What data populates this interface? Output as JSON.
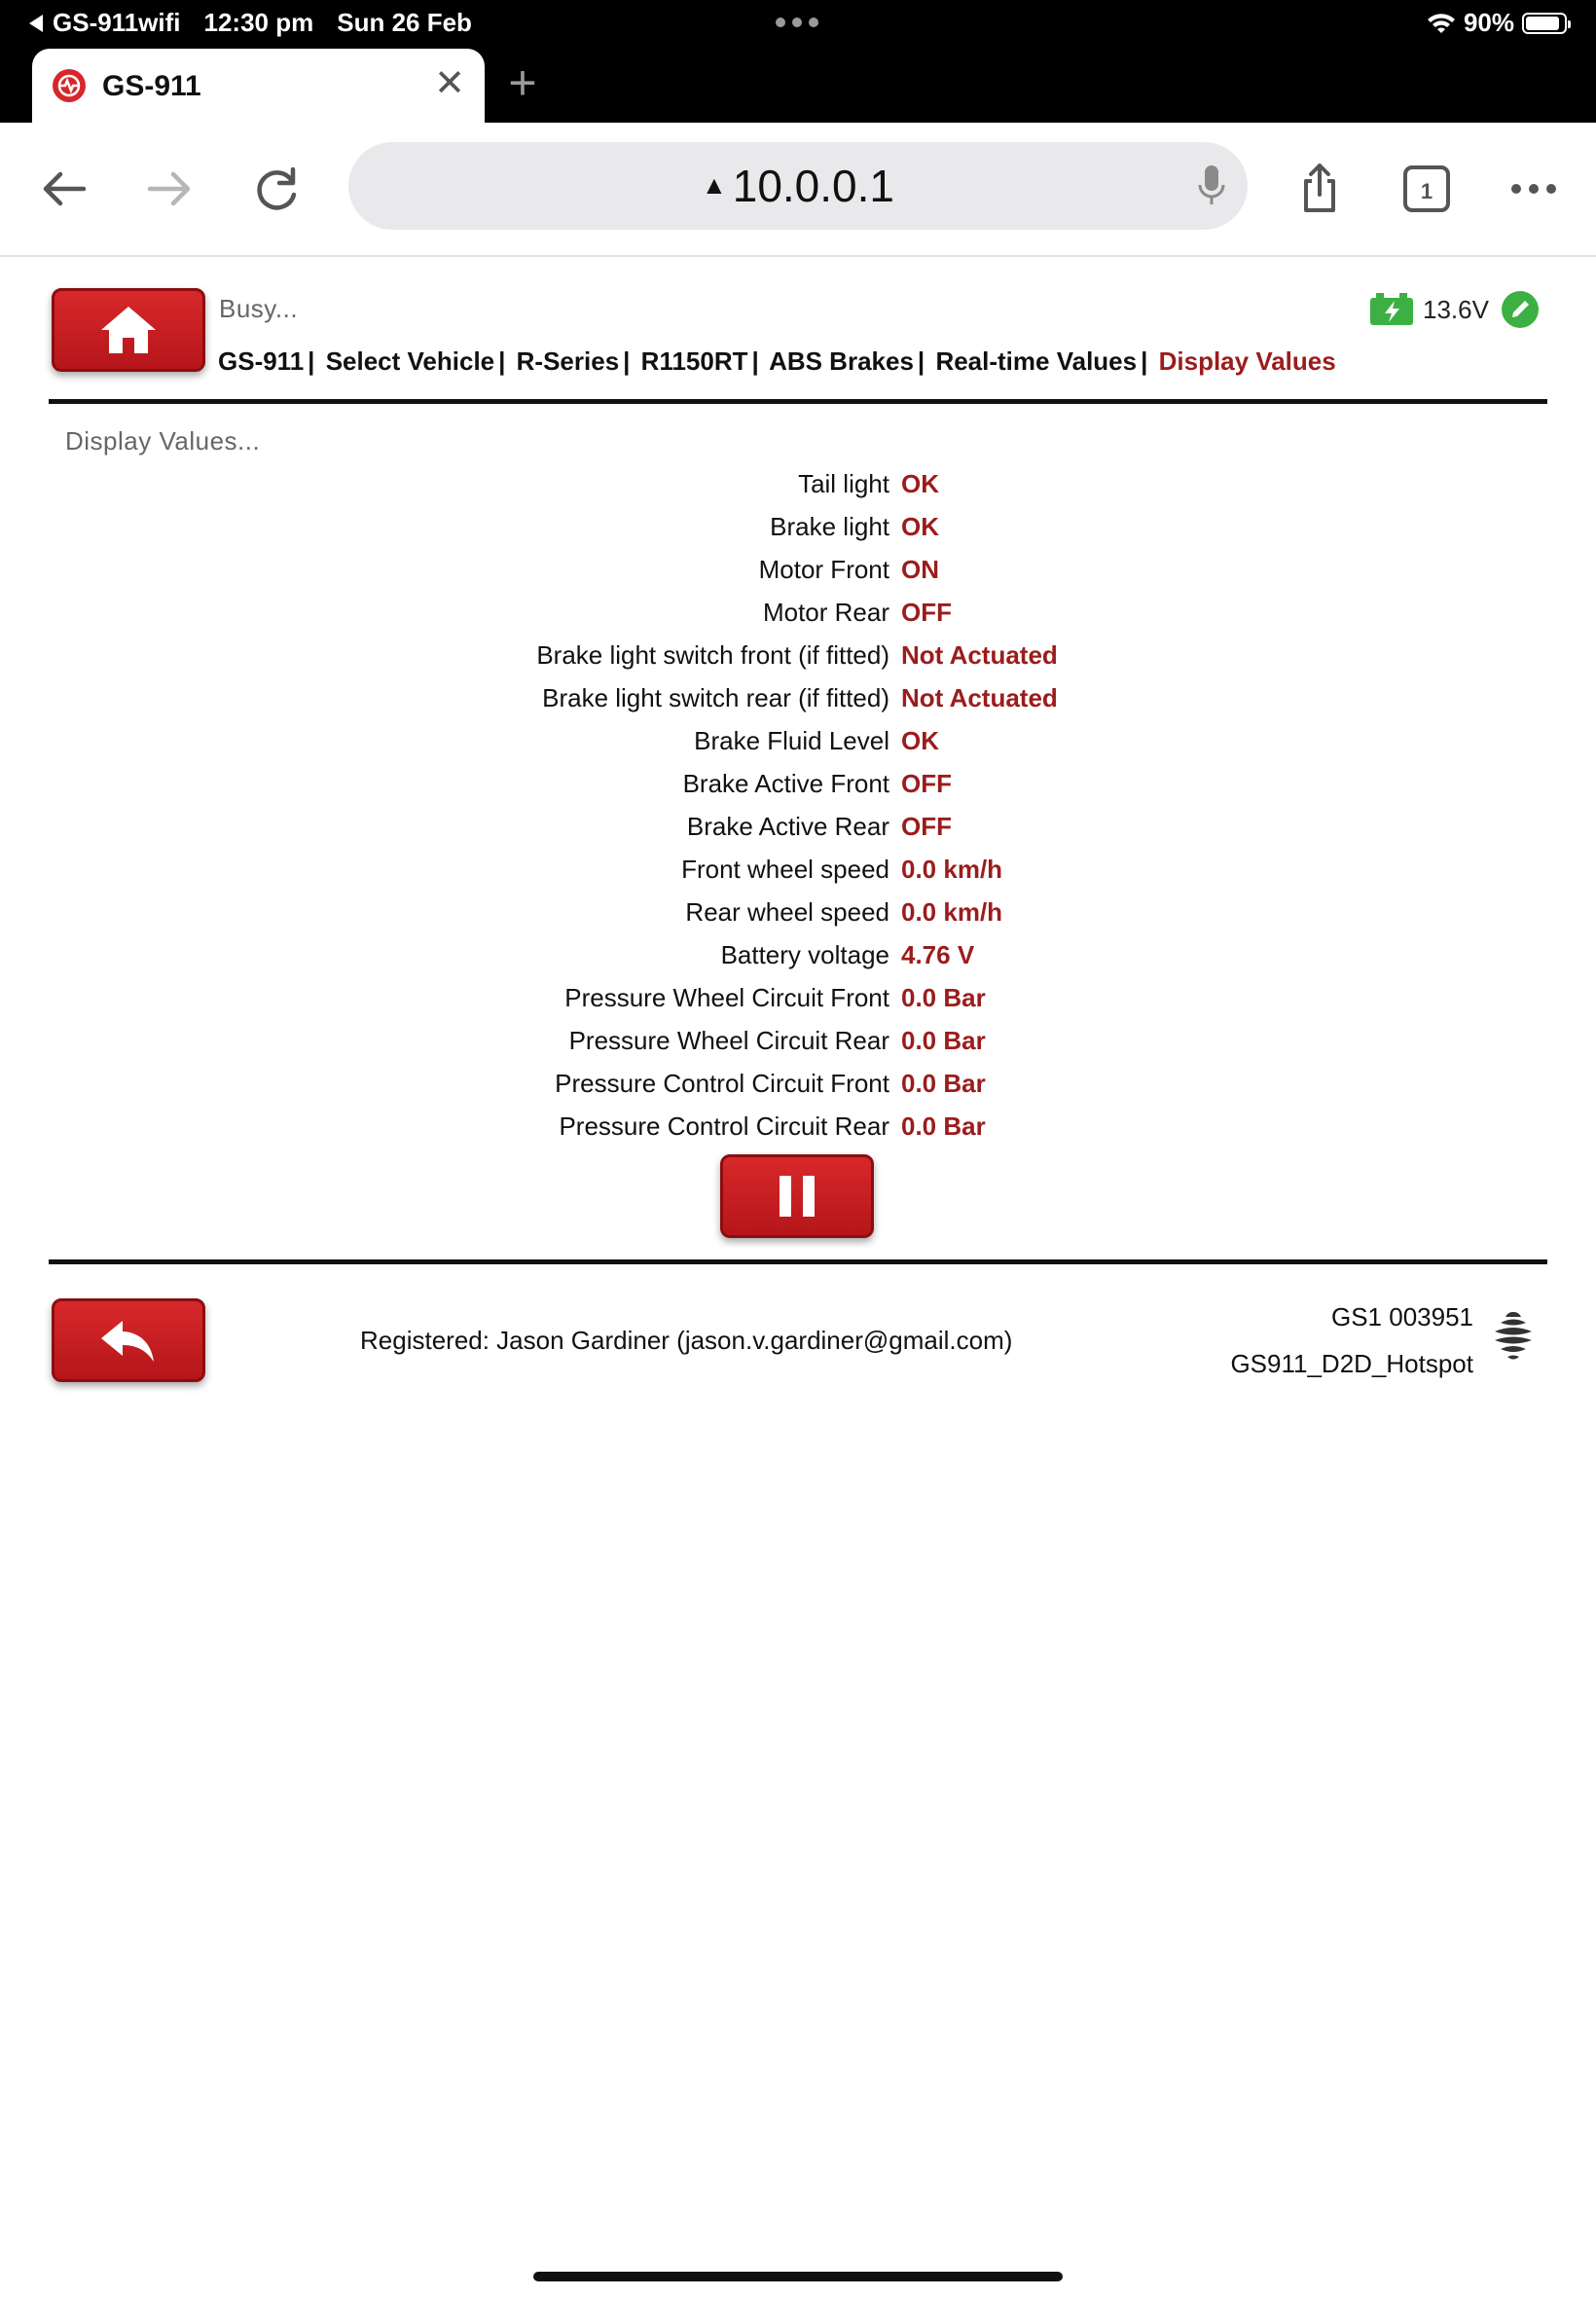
{
  "status_bar": {
    "carrier": "GS-911wifi",
    "time": "12:30 pm",
    "date": "Sun 26 Feb",
    "battery_percent": "90%",
    "battery_level": 0.9
  },
  "tab": {
    "title": "GS-911",
    "favicon": "gs911-logo-icon",
    "close_icon": "close-icon",
    "new_tab_icon": "plus-icon"
  },
  "toolbar": {
    "back_icon": "arrow-left-icon",
    "forward_icon": "arrow-right-icon",
    "reload_icon": "reload-icon",
    "url": "10.0.0.1",
    "url_warning_icon": "warning-triangle-icon",
    "mic_icon": "microphone-icon",
    "share_icon": "share-icon",
    "tabs_count": "1",
    "more_icon": "more-dots-icon"
  },
  "header": {
    "status": "Busy...",
    "breadcrumbs": [
      "GS-911",
      "Select Vehicle",
      "R-Series",
      "R1150RT",
      "ABS Brakes",
      "Real-time Values"
    ],
    "current_crumb": "Display Values",
    "separator": "|",
    "voltage": "13.6V",
    "battery_icon": "battery-charging-icon",
    "ok_icon": "pencil-check-icon",
    "home_icon": "home-icon"
  },
  "main": {
    "section_title": "Display Values...",
    "rows": [
      {
        "label": "Tail light",
        "value": "OK"
      },
      {
        "label": "Brake light",
        "value": "OK"
      },
      {
        "label": "Motor Front",
        "value": "ON"
      },
      {
        "label": "Motor Rear",
        "value": "OFF"
      },
      {
        "label": "Brake light switch front (if fitted)",
        "value": "Not Actuated"
      },
      {
        "label": "Brake light switch rear (if fitted)",
        "value": "Not Actuated"
      },
      {
        "label": "Brake Fluid Level",
        "value": "OK"
      },
      {
        "label": "Brake Active Front",
        "value": "OFF"
      },
      {
        "label": "Brake Active Rear",
        "value": "OFF"
      },
      {
        "label": "Front wheel speed",
        "value": "0.0 km/h"
      },
      {
        "label": "Rear wheel speed",
        "value": "0.0 km/h"
      },
      {
        "label": "Battery voltage",
        "value": "4.76 V"
      },
      {
        "label": "Pressure Wheel Circuit Front",
        "value": "0.0 Bar"
      },
      {
        "label": "Pressure Wheel Circuit Rear",
        "value": "0.0 Bar"
      },
      {
        "label": "Pressure Control Circuit Front",
        "value": "0.0 Bar"
      },
      {
        "label": "Pressure Control Circuit Rear",
        "value": "0.0 Bar"
      }
    ],
    "pause_icon": "pause-icon"
  },
  "footer": {
    "registered": "Registered: Jason Gardiner (jason.v.gardiner@gmail.com)",
    "serial": "GS1 003951",
    "network": "GS911_D2D_Hotspot",
    "back_icon": "undo-arrow-icon",
    "wifi_logo": "hexcode-wifi-logo-icon"
  },
  "colors": {
    "accent_red": "#c0191c",
    "value_red": "#9b1c1c",
    "status_green": "#3cb043"
  }
}
